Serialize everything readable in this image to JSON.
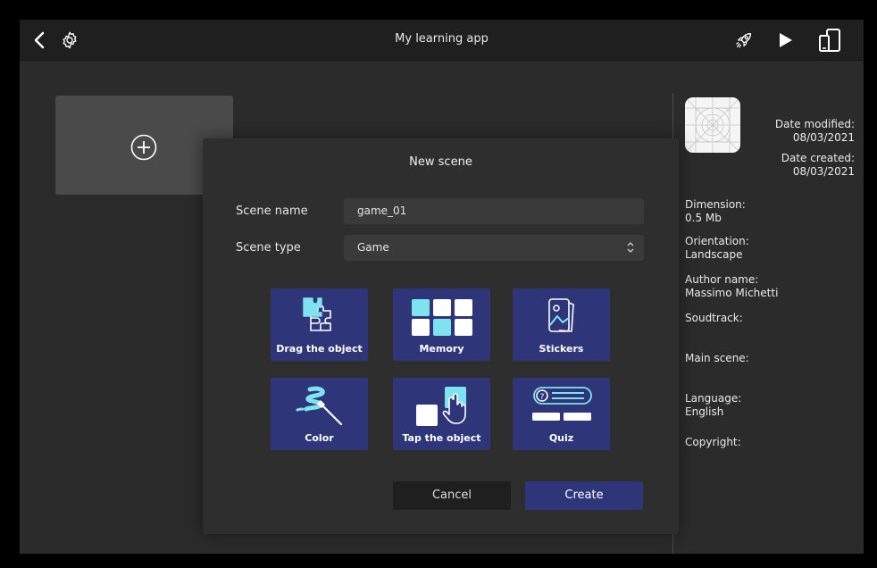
{
  "app": {
    "title": "My learning app"
  },
  "sidebar": {
    "date_modified_label": "Date modified:",
    "date_modified": "08/03/2021",
    "date_created_label": "Date created:",
    "date_created": "08/03/2021",
    "dimension_label": "Dimension:",
    "dimension": "0.5 Mb",
    "orientation_label": "Orientation:",
    "orientation": "Landscape",
    "author_label": "Author name:",
    "author": "Massimo Michetti",
    "soundtrack_label": "Soudtrack:",
    "main_scene_label": "Main scene:",
    "language_label": "Language:",
    "language": "English",
    "copyright_label": "Copyright:"
  },
  "modal": {
    "title": "New scene",
    "scene_name_label": "Scene name",
    "scene_name_value": "game_01",
    "scene_type_label": "Scene type",
    "scene_type_value": "Game",
    "tiles": [
      {
        "label": "Drag the object",
        "icon": "puzzle-icon"
      },
      {
        "label": "Memory",
        "icon": "memory-grid-icon"
      },
      {
        "label": "Stickers",
        "icon": "sticker-icon"
      },
      {
        "label": "Color",
        "icon": "paint-brush-icon"
      },
      {
        "label": "Tap the object",
        "icon": "tap-hand-icon"
      },
      {
        "label": "Quiz",
        "icon": "quiz-icon"
      }
    ],
    "cancel_label": "Cancel",
    "create_label": "Create"
  },
  "colors": {
    "accent": "#2f3579",
    "icon_cyan": "#7fe3ef",
    "background": "#2b2b2b"
  }
}
